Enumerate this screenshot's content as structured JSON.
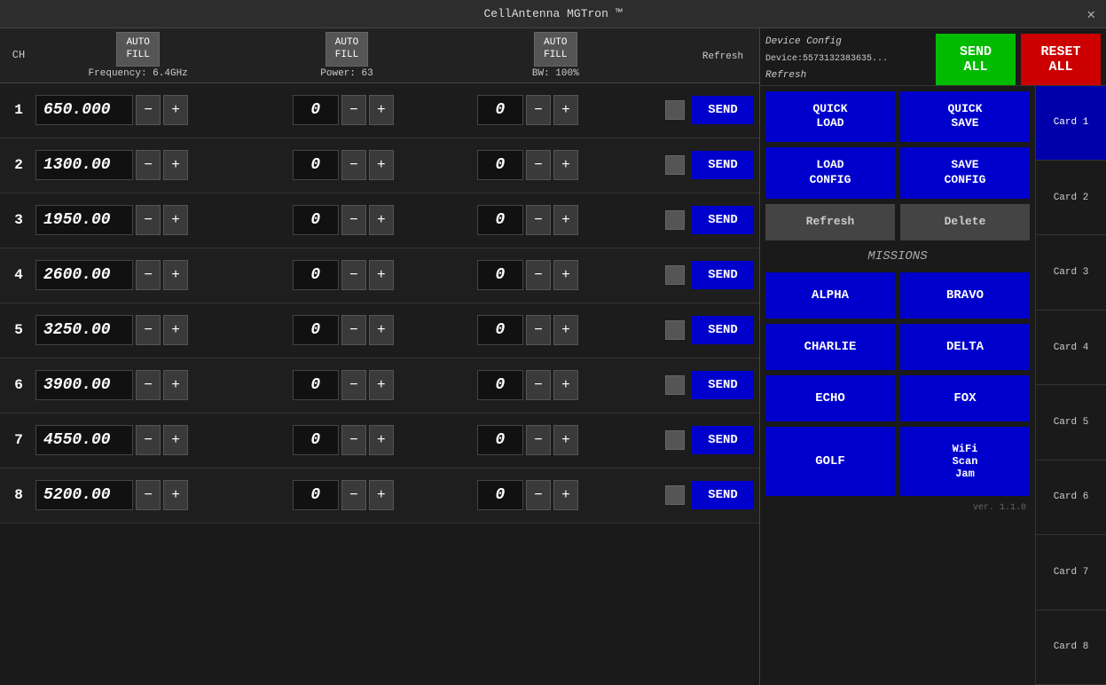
{
  "titleBar": {
    "title": "CellAntenna MGTron ™",
    "closeLabel": "✕"
  },
  "header": {
    "autoFillLabel": "AUTO\nFILL",
    "frequencyLabel": "Frequency: 6.4GHz",
    "powerLabel": "Power: 63",
    "bwLabel": "BW: 100%",
    "deviceConfig": "Device Config",
    "deviceId": "Device:5573132383635...",
    "refreshLabel": "Refresh",
    "sendAllLabel": "SEND\nALL",
    "resetAllLabel": "RESET\nALL"
  },
  "rows": [
    {
      "ch": 1,
      "freq": "650.000",
      "power": "0",
      "bw": "0"
    },
    {
      "ch": 2,
      "freq": "1300.00",
      "power": "0",
      "bw": "0"
    },
    {
      "ch": 3,
      "freq": "1950.00",
      "power": "0",
      "bw": "0"
    },
    {
      "ch": 4,
      "freq": "2600.00",
      "power": "0",
      "bw": "0"
    },
    {
      "ch": 5,
      "freq": "3250.00",
      "power": "0",
      "bw": "0"
    },
    {
      "ch": 6,
      "freq": "3900.00",
      "power": "0",
      "bw": "0"
    },
    {
      "ch": 7,
      "freq": "4550.00",
      "power": "0",
      "bw": "0"
    },
    {
      "ch": 8,
      "freq": "5200.00",
      "power": "0",
      "bw": "0"
    }
  ],
  "controls": {
    "quickLoadLabel": "QUICK\nLOAD",
    "quickSaveLabel": "QUICK\nSAVE",
    "loadConfigLabel": "LOAD\nCONFIG",
    "saveConfigLabel": "SAVE\nCONFIG",
    "refreshLabel": "Refresh",
    "deleteLabel": "Delete",
    "sendLabel": "SEND",
    "minusLabel": "−",
    "plusLabel": "+"
  },
  "missions": {
    "label": "MISSIONS",
    "buttons": [
      "ALPHA",
      "BRAVO",
      "CHARLIE",
      "DELTA",
      "ECHO",
      "FOX",
      "GOLF",
      "WiFi\nScan\nJam"
    ]
  },
  "cards": [
    {
      "label": "Card 1",
      "active": true
    },
    {
      "label": "Card 2",
      "active": false
    },
    {
      "label": "Card 3",
      "active": false
    },
    {
      "label": "Card 4",
      "active": false
    },
    {
      "label": "Card 5",
      "active": false
    },
    {
      "label": "Card 6",
      "active": false
    },
    {
      "label": "Card 7",
      "active": false
    },
    {
      "label": "Card 8",
      "active": false
    }
  ],
  "version": "ver. 1.1.0"
}
